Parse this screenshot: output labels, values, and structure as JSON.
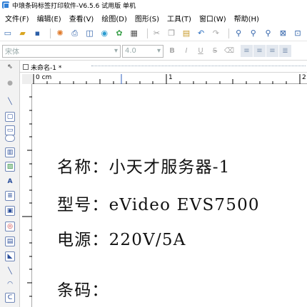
{
  "title": "中琅条码标签打印软件-V6.5.6 试用版 单机",
  "menu": [
    "文件(F)",
    "编辑(E)",
    "查看(V)",
    "绘图(D)",
    "图形(S)",
    "工具(T)",
    "窗口(W)",
    "帮助(H)"
  ],
  "font": {
    "name_placeholder": "宋体",
    "size_placeholder": "4.0"
  },
  "format_buttons": [
    "B",
    "I",
    "U",
    "S"
  ],
  "document_tab": "未命名-1 *",
  "ruler": {
    "h0": "0 cm",
    "h1": "1",
    "h2": "2"
  },
  "labels": {
    "name": "名称：小天才服务器-1",
    "model": "型号：eVideo EVS7500",
    "power": "电源：220V/5A",
    "barcode": "条码："
  },
  "colors": {
    "accent": "#2f7fd6",
    "icon_border": "#6f86b6"
  }
}
